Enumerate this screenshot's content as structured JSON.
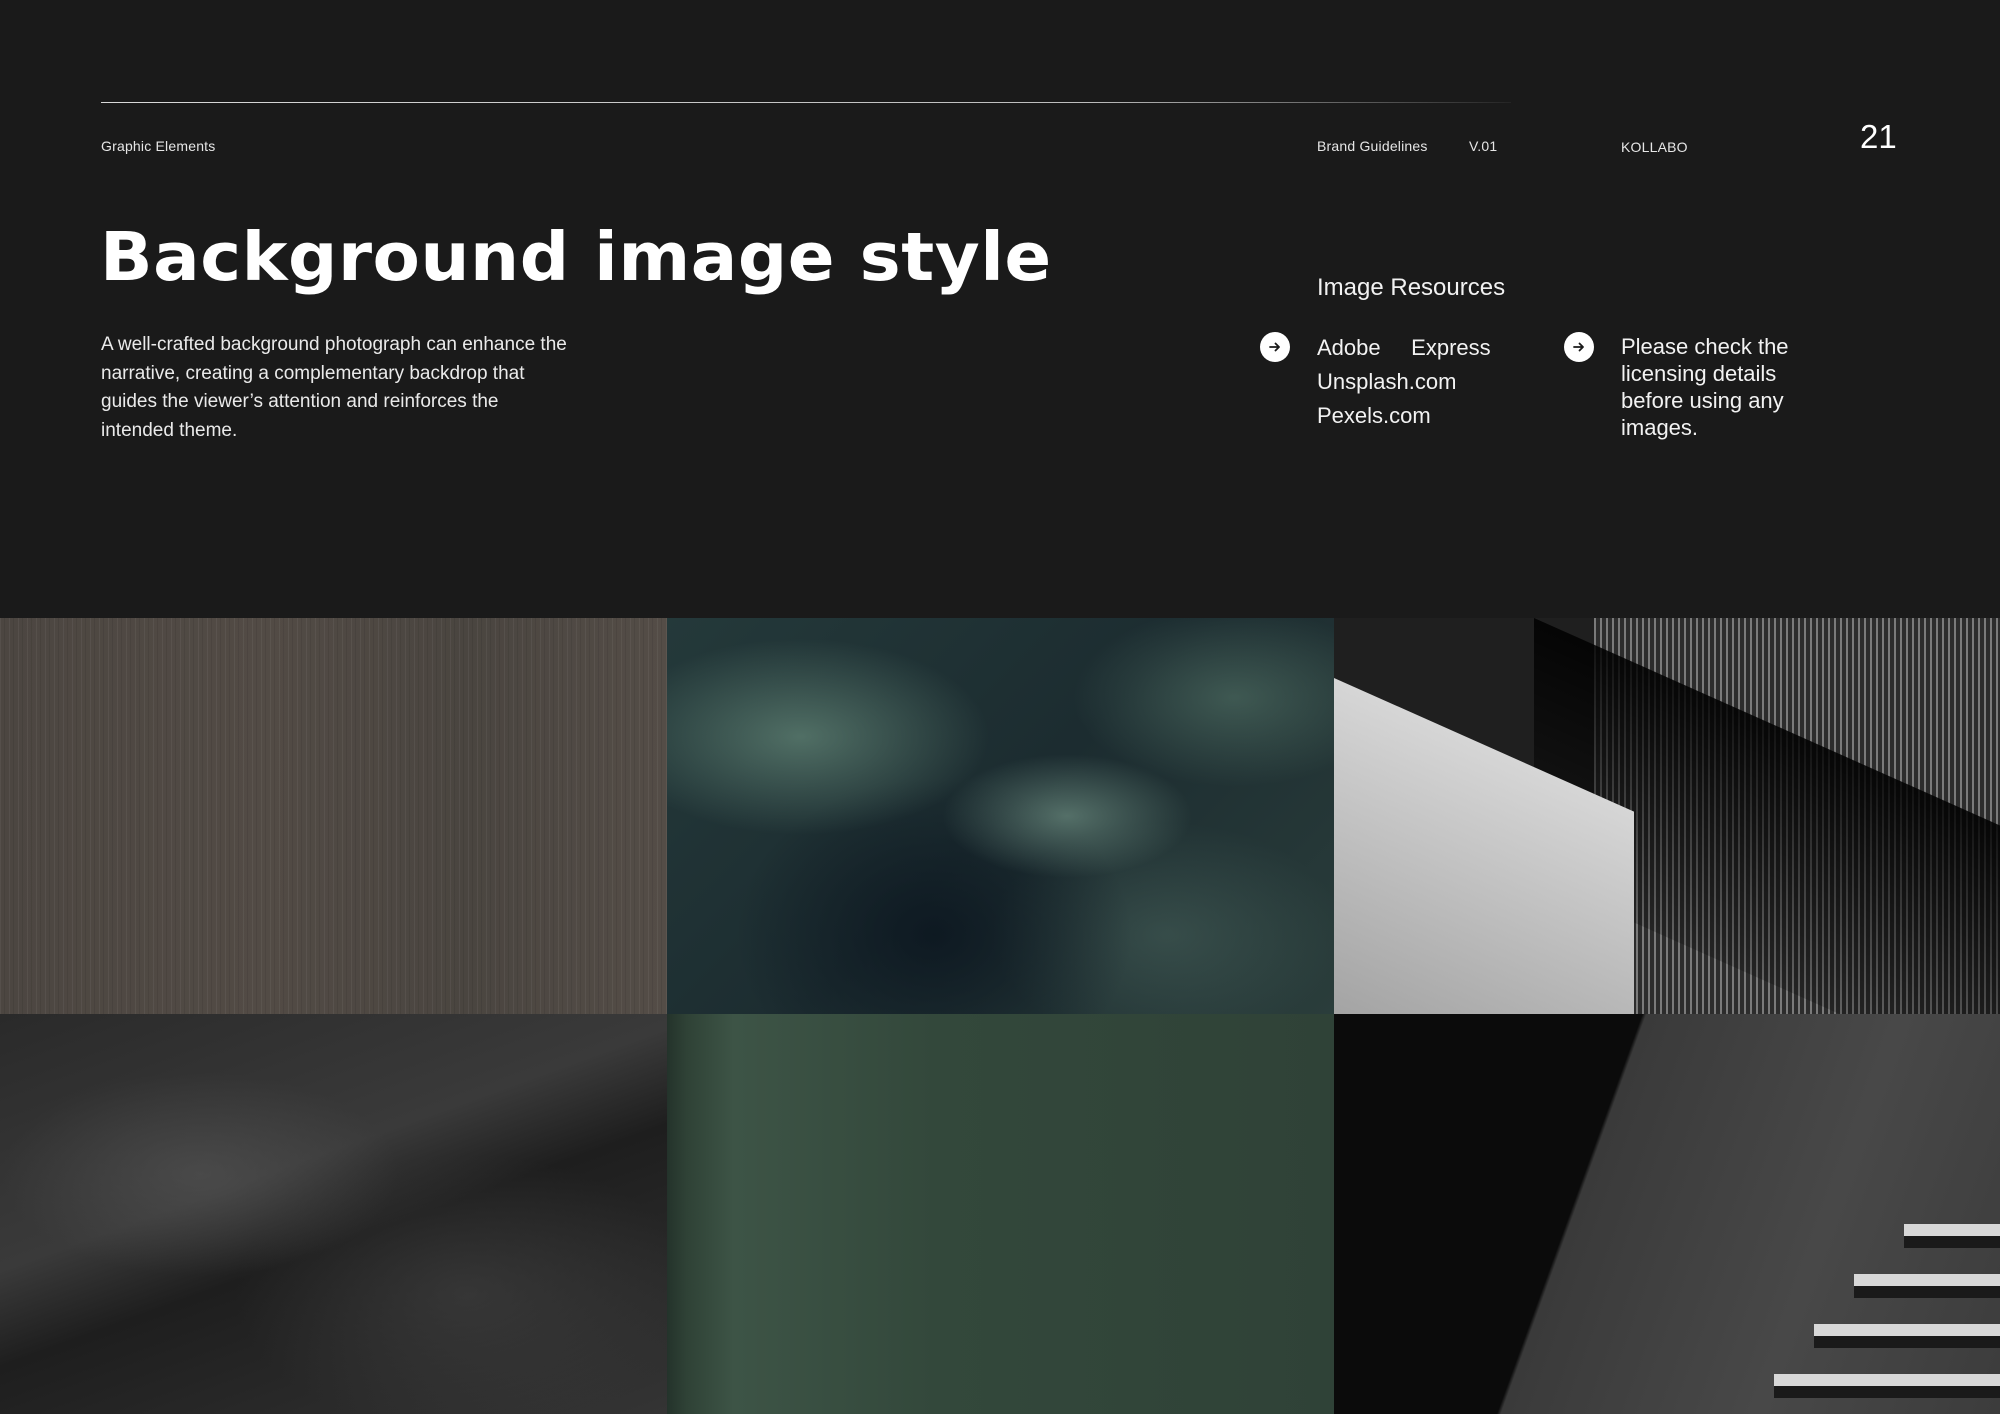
{
  "header": {
    "section": "Graphic Elements",
    "document": "Brand Guidelines",
    "version": "V.01",
    "company": "KOLLABO",
    "page_number": "21"
  },
  "main": {
    "title": "Background image style",
    "intro": "A well-crafted background photograph can enhance the narrative, creating a complementary backdrop that guides the viewer’s attention and reinforces the intended theme."
  },
  "resources": {
    "heading": "Image Resources",
    "items": [
      "Adobe     Express",
      "Unsplash.com",
      "Pexels.com"
    ],
    "notice": "Please check the licensing details before using any images.",
    "icon": "arrow-right-circle-icon"
  },
  "gallery": {
    "tiles": [
      "wood-texture",
      "green-marble-texture",
      "ribbed-architecture",
      "dark-stone-texture",
      "green-wall",
      "concrete-staircase"
    ]
  },
  "colors": {
    "background": "#1a1a1a",
    "text": "#ffffff"
  }
}
